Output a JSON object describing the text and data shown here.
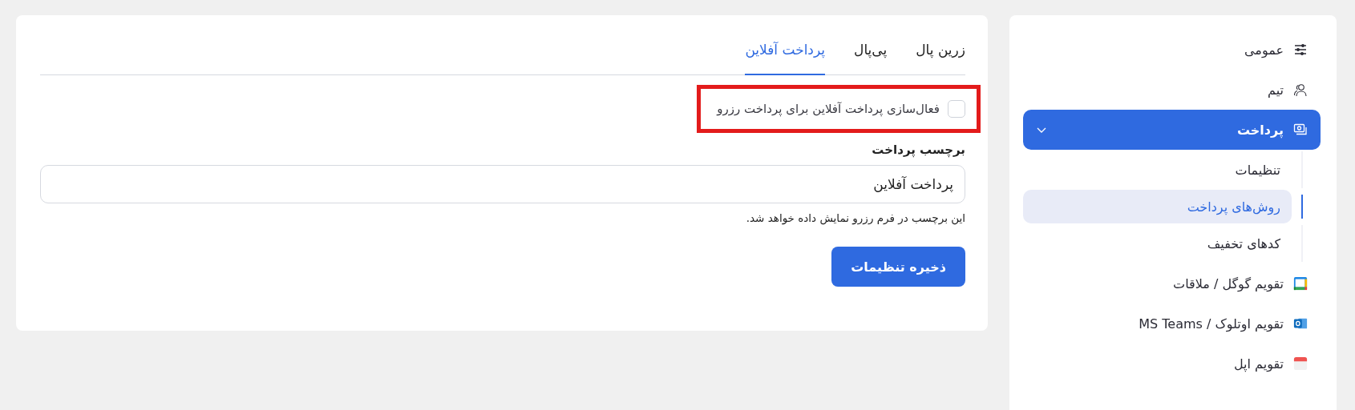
{
  "tabs": [
    {
      "label": "زرین پال",
      "selected": false
    },
    {
      "label": "پی‌پال",
      "selected": false
    },
    {
      "label": "پرداخت آفلاین",
      "selected": true
    }
  ],
  "offline_checkbox": {
    "label": "فعال‌سازی پرداخت آفلاین برای پرداخت رزرو",
    "checked": false,
    "highlighted": true
  },
  "payment_label_field": {
    "label": "برچسب پرداخت",
    "value": "پرداخت آفلاین",
    "help": "این برچسب در فرم رزرو نمایش داده خواهد شد."
  },
  "save_button": "ذخیره تنظیمات",
  "sidebar": {
    "items": [
      {
        "label": "عمومی",
        "selected": false
      },
      {
        "label": "تیم",
        "selected": false
      },
      {
        "label": "پرداخت",
        "selected": true,
        "expanded": true,
        "children": [
          {
            "label": "تنظیمات",
            "selected": false
          },
          {
            "label": "روش‌های پرداخت",
            "selected": true
          },
          {
            "label": "کدهای تخفیف",
            "selected": false
          }
        ]
      },
      {
        "label": "تقویم گوگل / ملاقات",
        "selected": false
      },
      {
        "label": "تقویم اوتلوک / MS Teams",
        "selected": false
      },
      {
        "label": "تقویم اپل",
        "selected": false
      }
    ]
  }
}
